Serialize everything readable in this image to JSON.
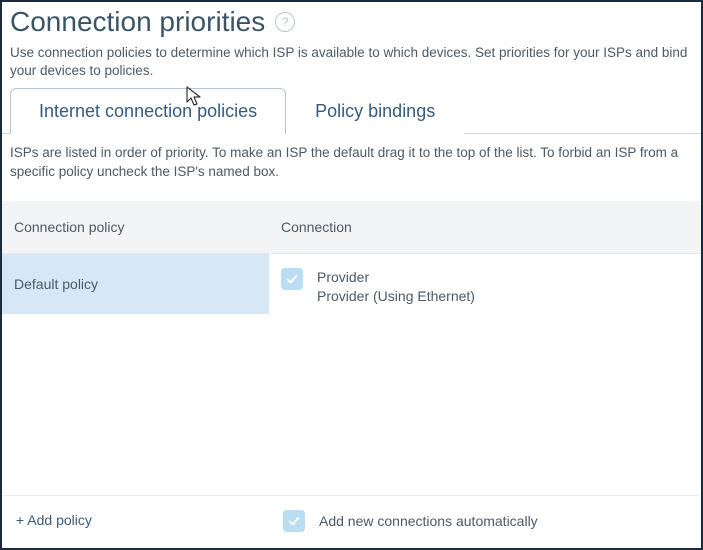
{
  "header": {
    "title": "Connection priorities",
    "help_tooltip": "?"
  },
  "intro": "Use connection policies to determine which ISP is available to which devices. Set priorities for your ISPs and bind your devices to policies.",
  "tabs": [
    {
      "label": "Internet connection policies",
      "active": true
    },
    {
      "label": "Policy bindings",
      "active": false
    }
  ],
  "tab_help": "ISPs are listed in order of priority. To make an ISP the default drag it to the top of the list. To forbid an ISP from a specific policy uncheck the ISP's named box.",
  "table": {
    "headers": {
      "policy": "Connection policy",
      "connection": "Connection"
    },
    "policy_rows": [
      {
        "name": "Default policy",
        "selected": true
      }
    ],
    "connection_rows": [
      {
        "checked": true,
        "title": "Provider",
        "subtitle": "Provider (Using Ethernet)"
      }
    ]
  },
  "footer": {
    "add_policy": "+ Add policy",
    "auto_add": {
      "checked": true,
      "label": "Add new connections automatically"
    }
  },
  "icons": {
    "help": "help-icon",
    "check": "check-icon",
    "cursor": "cursor-icon"
  }
}
